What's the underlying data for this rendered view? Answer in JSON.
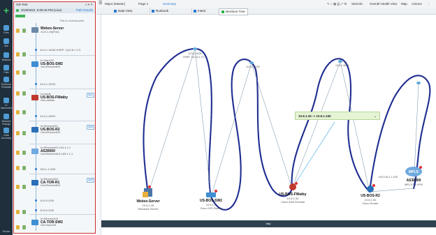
{
  "nav": {
    "items": [
      {
        "label": "Files"
      },
      {
        "label": "Site"
      },
      {
        "label": "Network"
      },
      {
        "label": "Path"
      },
      {
        "label": "Runbook Template"
      },
      {
        "label": "In Instrument"
      },
      {
        "label": "Network Change"
      },
      {
        "label": "Data Accuracy"
      },
      {
        "label": "Map"
      },
      {
        "label": "Device"
      }
    ]
  },
  "panel": {
    "title": "GD-Test",
    "time": "8/19/2022, 6:09:16 PM (Live)",
    "details_label": "Path Details",
    "unicast_note": "This is Unicast path.",
    "hops": [
      {
        "name": "Webex-Server",
        "sub": "10.8.1.26(Port)",
        "tag": ""
      },
      {
        "name": "US-BOS-SW2",
        "pre": "In:Vlan101",
        "sub": "Out:Ethernet0/3",
        "tag": ""
      },
      {
        "name": "US-BOS-FWatby",
        "pre": "In:inside",
        "sub": "Out:outside",
        "tag": "ACL"
      },
      {
        "name": "US-BOS-R2",
        "pre": "In:Ethernet0/1",
        "sub": "Out:Ethernet0/3",
        "tag": "QoS"
      },
      {
        "name": "AS30000",
        "pre": "In:Ethernet0/2-104.1.1.1",
        "sub": "Out:Ethernet0/3-159.1.1.1",
        "tag": ""
      },
      {
        "name": "CA-TOR-R1",
        "pre": "In:Ethernet0/2",
        "sub": "Out:Ethernet0/3",
        "tag": "QoS"
      },
      {
        "name": "CA-TOR-SW2",
        "pre": "In:Ethernet1/0",
        "sub": "Out:Vlan100",
        "tag": ""
      }
    ],
    "links": [
      "10.8.1.16/28 HSRP: 1(10.8.1.17)",
      "10.8.1.32/29",
      "10.8.1.48/29",
      "159.1.1.0/30",
      "10.8.0.0/30",
      "10.8.0.0/30"
    ]
  },
  "topbar": {
    "map_name": "Map4 (Master)",
    "page": "Page 1",
    "summary": "Summary",
    "stencils": "Stencils",
    "overall_health": "Overall Health View",
    "map": "Map",
    "actions": "Actions"
  },
  "tabs": [
    {
      "label": "Data View"
    },
    {
      "label": "Runbook"
    },
    {
      "label": "Intent"
    }
  ],
  "decision_tree": "Decision Tree",
  "map": {
    "devices": [
      {
        "name": "Webex-Server",
        "ip": "10.8.1.26",
        "type": "Windows Server"
      },
      {
        "name": "US-BOS-SW2",
        "ip": "10.8.1.3",
        "type": "Cisco IOS Switch"
      },
      {
        "name": "US-BOS-FWatby",
        "ip": "10.8.1.50",
        "type": "Cisco ASA Firewall"
      },
      {
        "name": "US-BOS-R2",
        "ip": "10.8.1.52",
        "type": "Cisco Router"
      },
      {
        "name": "AS30000",
        "ip": "",
        "type": "MPLS L3 VPN"
      }
    ],
    "mpls_label": "MPLS",
    "callout": "10.8.1.26 -> 10.8.1.150",
    "link_labels": [
      "10.8.1.16/28",
      "HSRP: 1(10.8.1.17)",
      "10.8.1.32/29",
      "10.8.1.48/29",
      "e0/3 104.1.1.2/30"
    ]
  },
  "colors": {
    "path_dots": "#1d2c8f",
    "highlight_border": "#d02a2a",
    "callout_bg": "#e6f4d6",
    "nav_bg": "#1f2f3b"
  }
}
